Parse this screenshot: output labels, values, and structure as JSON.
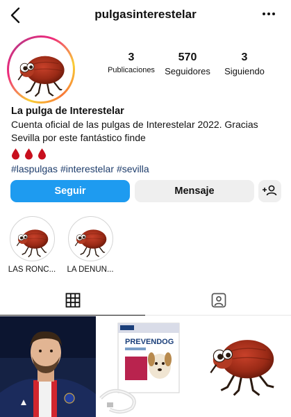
{
  "header": {
    "username": "pulgasinterestelar",
    "back_icon": "chevron-left-icon",
    "more_icon": "more-horizontal-icon"
  },
  "profile": {
    "stats": [
      {
        "value": "3",
        "label": "Publicaciones"
      },
      {
        "value": "570",
        "label": "Seguidores"
      },
      {
        "value": "3",
        "label": "Siguiendo"
      }
    ],
    "name": "La pulga de Interestelar",
    "bio": "Cuenta oficial de las pulgas de Interestelar 2022. Gracias Sevilla por este fantástico finde",
    "emoji": [
      "drop-of-blood",
      "drop-of-blood",
      "drop-of-blood"
    ],
    "hashtags": [
      "#laspulgas",
      "#interestelar",
      "#sevilla"
    ]
  },
  "actions": {
    "follow": "Seguir",
    "message": "Mensaje",
    "add_user_icon": "add-user-icon"
  },
  "highlights": [
    {
      "label": "LAS RONC..."
    },
    {
      "label": "LA DENUN..."
    }
  ],
  "tabs": [
    {
      "icon": "grid-icon",
      "active": true
    },
    {
      "icon": "tagged-icon",
      "active": false
    }
  ],
  "posts": [
    {
      "subject": "football player photo"
    },
    {
      "subject": "PREVENDOG product box",
      "text": "PREVENDOG"
    },
    {
      "subject": "flea cartoon"
    }
  ],
  "colors": {
    "follow_button": "#1e9bf0",
    "secondary_button": "#efefef",
    "hashtag": "#1d3c6b",
    "flea": "#9a2a16"
  }
}
